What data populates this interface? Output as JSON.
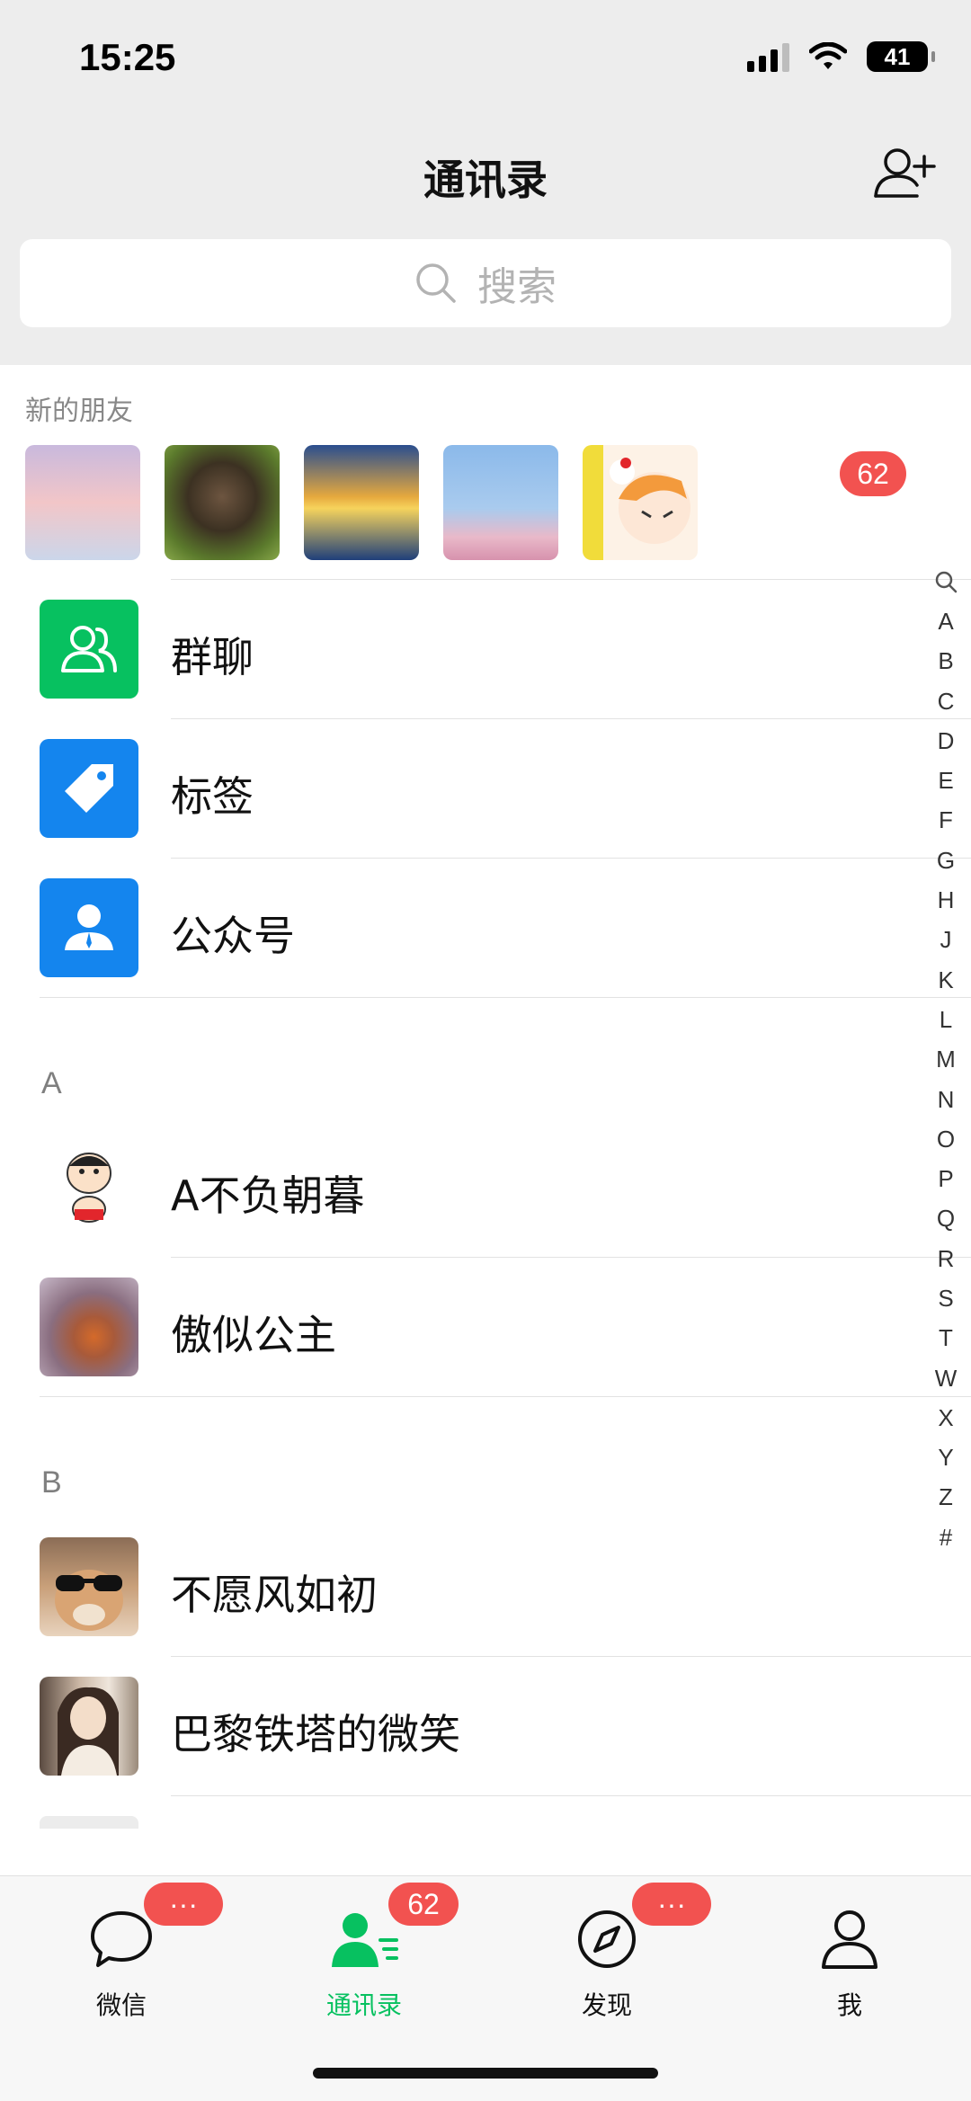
{
  "status_bar": {
    "time": "15:25",
    "battery": "41"
  },
  "header": {
    "title": "通讯录"
  },
  "search": {
    "placeholder": "搜索"
  },
  "new_friends": {
    "label": "新的朋友",
    "badge": "62"
  },
  "functions": [
    {
      "label": "群聊",
      "icon": "group-chat-icon",
      "color": "#07c160"
    },
    {
      "label": "标签",
      "icon": "tag-icon",
      "color": "#1485ee"
    },
    {
      "label": "公众号",
      "icon": "official-account-icon",
      "color": "#1485ee"
    }
  ],
  "sections": [
    {
      "letter": "A",
      "contacts": [
        "A不负朝暮",
        "傲似公主"
      ]
    },
    {
      "letter": "B",
      "contacts": [
        "不愿风如初",
        "巴黎铁塔的微笑"
      ]
    }
  ],
  "index_letters": [
    "A",
    "B",
    "C",
    "D",
    "E",
    "F",
    "G",
    "H",
    "J",
    "K",
    "L",
    "M",
    "N",
    "O",
    "P",
    "Q",
    "R",
    "S",
    "T",
    "W",
    "X",
    "Y",
    "Z",
    "#"
  ],
  "tabs": [
    {
      "label": "微信",
      "badge": "···",
      "active": false
    },
    {
      "label": "通讯录",
      "badge": "62",
      "active": true
    },
    {
      "label": "发现",
      "badge": "···",
      "active": false
    },
    {
      "label": "我",
      "badge": "",
      "active": false
    }
  ],
  "colors": {
    "accent": "#07c160",
    "badge": "#f25250",
    "blue": "#1485ee"
  }
}
